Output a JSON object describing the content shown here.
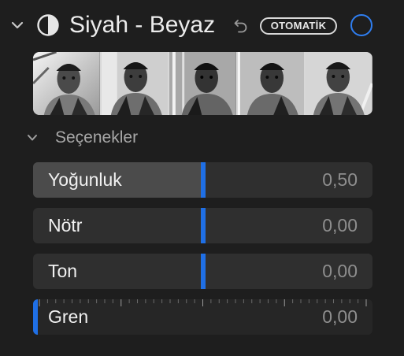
{
  "header": {
    "title": "Siyah - Beyaz",
    "auto_label": "OTOMATİK",
    "icons": {
      "disclosure": "chevron-down-icon",
      "effect": "black-white-icon",
      "revert": "undo-icon",
      "toggle": "circle-toggle-icon"
    },
    "accent_color": "#2f7ef0"
  },
  "preview": {
    "thumbnail_count": 5
  },
  "options": {
    "label": "Seçenekler"
  },
  "sliders": [
    {
      "label": "Yoğunluk",
      "value": "0,50",
      "level": 0.5
    },
    {
      "label": "Nötr",
      "value": "0,00",
      "level": 0.5
    },
    {
      "label": "Ton",
      "value": "0,00",
      "level": 0.5
    },
    {
      "label": "Gren",
      "value": "0,00",
      "level": 0.0
    }
  ],
  "colors": {
    "background": "#1e1e1e",
    "slider_track": "#2f2f2f",
    "slider_fill": "#4b4b4b",
    "handle": "#1f6fe5"
  }
}
